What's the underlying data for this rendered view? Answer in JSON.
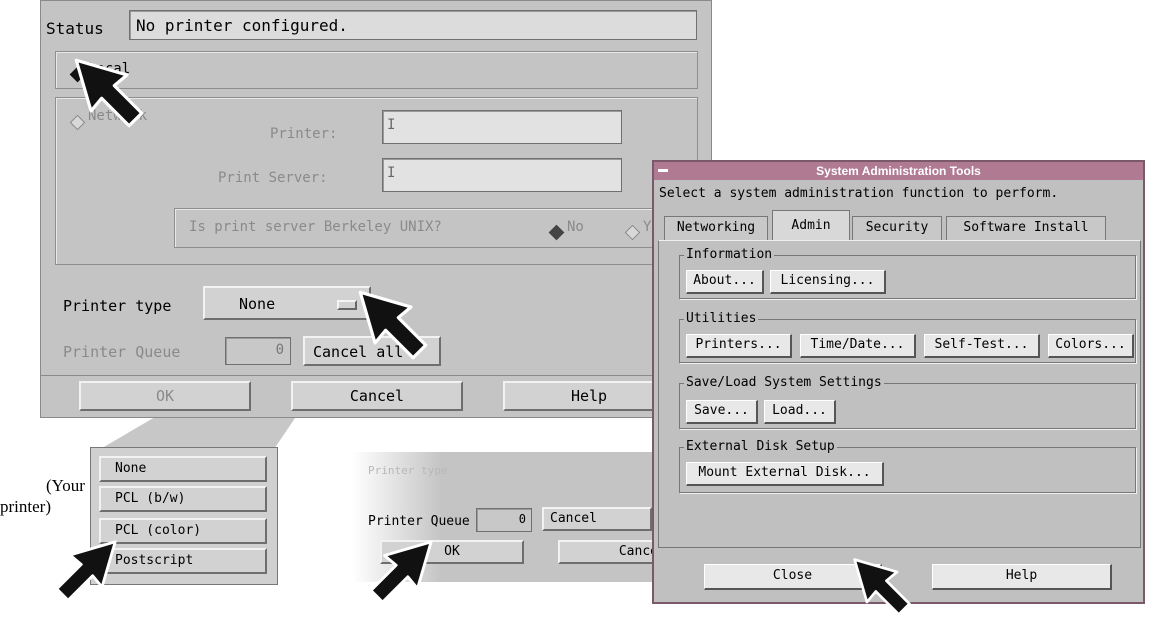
{
  "printer_dialog": {
    "status_label": "Status",
    "status_value": "No printer configured.",
    "local_label": "Local",
    "network_label": "Network",
    "printer_field_label": "Printer:",
    "print_server_label": "Print Server:",
    "unix_question": "Is print server Berkeley UNIX?",
    "unix_no": "No",
    "unix_yes": "Y",
    "printer_type_label": "Printer type",
    "printer_type_value": "None",
    "printer_queue_label": "Printer Queue",
    "printer_queue_value": "0",
    "cancel_all_label": "Cancel all",
    "ok_label": "OK",
    "cancel_label": "Cancel",
    "help_label": "Help"
  },
  "printer_type_menu": {
    "options": [
      "None",
      "PCL (b/w)",
      "PCL (color)",
      "Postscript"
    ]
  },
  "callout": {
    "line1": "(Your",
    "line2": "printer)"
  },
  "mini_dialog": {
    "printer_type_label": "Printer type",
    "printer_queue_label": "Printer Queue",
    "printer_queue_value": "0",
    "cancel_label": "Cancel",
    "ok_label": "OK",
    "cancel2_label": "Cance"
  },
  "sat": {
    "title": "System Administration Tools",
    "prompt": "Select a system administration function to perform.",
    "tabs": [
      "Networking",
      "Admin",
      "Security",
      "Software Install"
    ],
    "active_tab": "Admin",
    "groups": {
      "information": {
        "label": "Information",
        "buttons": [
          "About...",
          "Licensing..."
        ]
      },
      "utilities": {
        "label": "Utilities",
        "buttons": [
          "Printers...",
          "Time/Date...",
          "Self-Test...",
          "Colors..."
        ]
      },
      "save_load": {
        "label": "Save/Load System Settings",
        "buttons": [
          "Save...",
          "Load..."
        ]
      },
      "external_disk": {
        "label": "External Disk Setup",
        "buttons": [
          "Mount External Disk..."
        ]
      }
    },
    "close_label": "Close",
    "help_label": "Help"
  },
  "colors": {
    "dialog_bg": "#c4c4c4",
    "title_bar": "#b07a92",
    "arrow_fill": "#111111"
  }
}
